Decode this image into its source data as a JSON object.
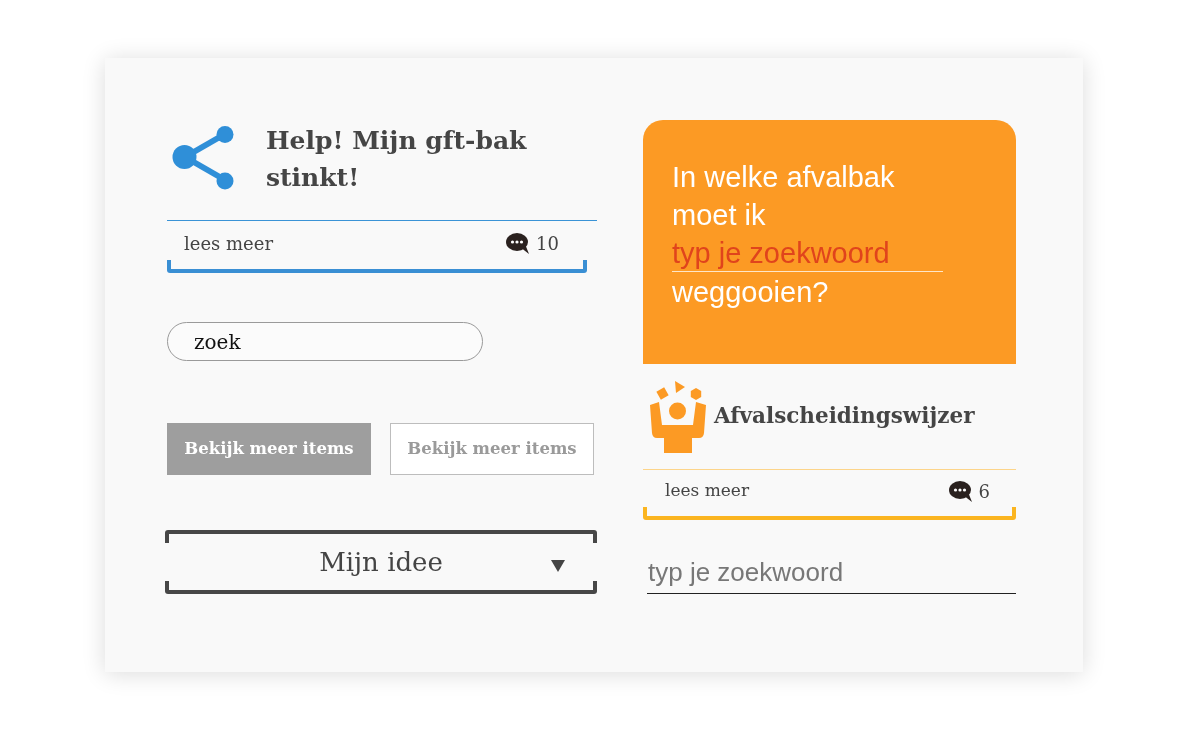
{
  "article_card": {
    "title": "Help! Mijn gft-bak stinkt!",
    "link": "lees meer",
    "comments": "10"
  },
  "search": {
    "value": "zoek"
  },
  "buttons": [
    {
      "label": "Bekijk meer items",
      "kind": "filled"
    },
    {
      "label": "Bekijk meer items",
      "kind": "outline"
    }
  ],
  "dropdown": {
    "label": "Mijn idee"
  },
  "question_banner": {
    "text_before": "In welke afvalbak moet ik",
    "field": {
      "placeholder": "typ je zoekwoord"
    },
    "text_after": "weggooien?"
  },
  "tool_card": {
    "title": "Afvalscheidingswijzer",
    "link": "lees meer",
    "comments": "6"
  },
  "keyword_field": {
    "placeholder": "typ je zoekwoord"
  }
}
